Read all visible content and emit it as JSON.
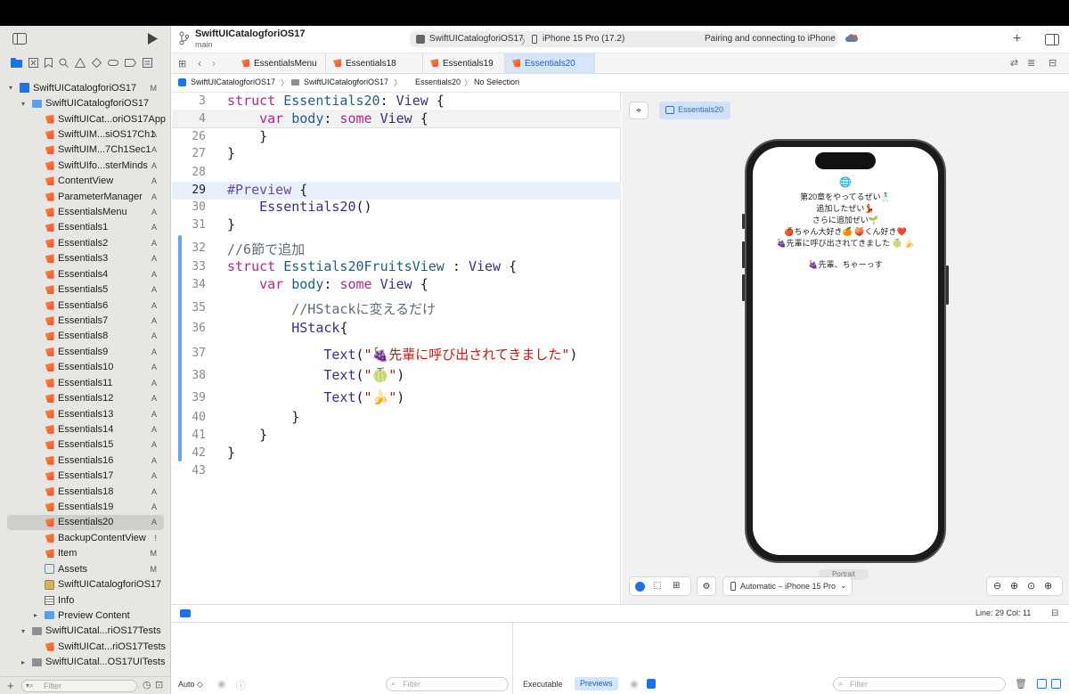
{
  "toolbar": {
    "project_name": "SwiftUICatalogforiOS17",
    "branch": "main",
    "scheme": "SwiftUICatalogforiOS17",
    "destination": "iPhone 15 Pro (17.2)",
    "status": "Pairing and connecting to iPhone"
  },
  "tabs": [
    {
      "label": "EssentialsMenu"
    },
    {
      "label": "Essentials18"
    },
    {
      "label": "Essentials19"
    },
    {
      "label": "Essentials20"
    }
  ],
  "jumpbar": {
    "project": "SwiftUICatalogforiOS17",
    "group": "SwiftUICatalogforiOS17",
    "file": "Essentials20",
    "selection": "No Selection"
  },
  "navigator": [
    {
      "label": "SwiftUICatalogforiOS17",
      "badge": "M",
      "icon": "project-icon",
      "indent": 0,
      "disc": "v"
    },
    {
      "label": "SwiftUICatalogforiOS17",
      "badge": "",
      "icon": "folder-icon",
      "indent": 1,
      "disc": "v"
    },
    {
      "label": "SwiftUICat...oriOS17App",
      "badge": "",
      "icon": "swift-file-icon",
      "indent": 2,
      "disc": ""
    },
    {
      "label": "SwiftUIM...siOS17Ch1",
      "badge": "A",
      "icon": "swift-file-icon",
      "indent": 2,
      "disc": ""
    },
    {
      "label": "SwiftUIM...7Ch1Sec1",
      "badge": "A",
      "icon": "swift-file-icon",
      "indent": 2,
      "disc": ""
    },
    {
      "label": "SwiftUIfo...sterMinds",
      "badge": "A",
      "icon": "swift-file-icon",
      "indent": 2,
      "disc": ""
    },
    {
      "label": "ContentView",
      "badge": "A",
      "icon": "swift-file-icon",
      "indent": 2,
      "disc": ""
    },
    {
      "label": "ParameterManager",
      "badge": "A",
      "icon": "swift-file-icon",
      "indent": 2,
      "disc": ""
    },
    {
      "label": "EssentialsMenu",
      "badge": "A",
      "icon": "swift-file-icon",
      "indent": 2,
      "disc": ""
    },
    {
      "label": "Essentials1",
      "badge": "A",
      "icon": "swift-file-icon",
      "indent": 2,
      "disc": ""
    },
    {
      "label": "Essentials2",
      "badge": "A",
      "icon": "swift-file-icon",
      "indent": 2,
      "disc": ""
    },
    {
      "label": "Essentials3",
      "badge": "A",
      "icon": "swift-file-icon",
      "indent": 2,
      "disc": ""
    },
    {
      "label": "Essentials4",
      "badge": "A",
      "icon": "swift-file-icon",
      "indent": 2,
      "disc": ""
    },
    {
      "label": "Essentials5",
      "badge": "A",
      "icon": "swift-file-icon",
      "indent": 2,
      "disc": ""
    },
    {
      "label": "Essentials6",
      "badge": "A",
      "icon": "swift-file-icon",
      "indent": 2,
      "disc": ""
    },
    {
      "label": "Essentials7",
      "badge": "A",
      "icon": "swift-file-icon",
      "indent": 2,
      "disc": ""
    },
    {
      "label": "Essentials8",
      "badge": "A",
      "icon": "swift-file-icon",
      "indent": 2,
      "disc": ""
    },
    {
      "label": "Essentials9",
      "badge": "A",
      "icon": "swift-file-icon",
      "indent": 2,
      "disc": ""
    },
    {
      "label": "Essentials10",
      "badge": "A",
      "icon": "swift-file-icon",
      "indent": 2,
      "disc": ""
    },
    {
      "label": "Essentials11",
      "badge": "A",
      "icon": "swift-file-icon",
      "indent": 2,
      "disc": ""
    },
    {
      "label": "Essentials12",
      "badge": "A",
      "icon": "swift-file-icon",
      "indent": 2,
      "disc": ""
    },
    {
      "label": "Essentials13",
      "badge": "A",
      "icon": "swift-file-icon",
      "indent": 2,
      "disc": ""
    },
    {
      "label": "Essentials14",
      "badge": "A",
      "icon": "swift-file-icon",
      "indent": 2,
      "disc": ""
    },
    {
      "label": "Essentials15",
      "badge": "A",
      "icon": "swift-file-icon",
      "indent": 2,
      "disc": ""
    },
    {
      "label": "Essentials16",
      "badge": "A",
      "icon": "swift-file-icon",
      "indent": 2,
      "disc": ""
    },
    {
      "label": "Essentials17",
      "badge": "A",
      "icon": "swift-file-icon",
      "indent": 2,
      "disc": ""
    },
    {
      "label": "Essentials18",
      "badge": "A",
      "icon": "swift-file-icon",
      "indent": 2,
      "disc": ""
    },
    {
      "label": "Essentials19",
      "badge": "A",
      "icon": "swift-file-icon",
      "indent": 2,
      "disc": ""
    },
    {
      "label": "Essentials20",
      "badge": "A",
      "icon": "swift-file-icon",
      "indent": 2,
      "disc": "",
      "selected": true
    },
    {
      "label": "BackupContentView",
      "badge": "!",
      "icon": "swift-file-icon",
      "indent": 2,
      "disc": ""
    },
    {
      "label": "Item",
      "badge": "M",
      "icon": "swift-file-icon",
      "indent": 2,
      "disc": ""
    },
    {
      "label": "Assets",
      "badge": "M",
      "icon": "asset-catalog-icon",
      "indent": 2,
      "disc": ""
    },
    {
      "label": "SwiftUICatalogforiOS17",
      "badge": "",
      "icon": "entitlements-icon",
      "indent": 2,
      "disc": ""
    },
    {
      "label": "Info",
      "badge": "",
      "icon": "plist-icon",
      "indent": 2,
      "disc": ""
    },
    {
      "label": "Preview Content",
      "badge": "",
      "icon": "folder-icon",
      "indent": 2,
      "disc": ">"
    },
    {
      "label": "SwiftUICatal...riOS17Tests",
      "badge": "",
      "icon": "folder-gray-icon",
      "indent": 1,
      "disc": "v"
    },
    {
      "label": "SwiftUICat...riOS17Tests",
      "badge": "",
      "icon": "swift-file-icon",
      "indent": 2,
      "disc": ""
    },
    {
      "label": "SwiftUICatal...OS17UITests",
      "badge": "",
      "icon": "folder-gray-icon",
      "indent": 1,
      "disc": ">"
    }
  ],
  "code": [
    {
      "n": "3",
      "html": "<span class='kw'>struct</span> <span class='id'>Essentials20</span>: <span class='ty'>View</span> {"
    },
    {
      "n": "4",
      "html": "    <span class='kw'>var</span> <span class='id'>body</span>: <span class='kw'>some</span> <span class='ty'>View</span> {"
    },
    {
      "n": "26",
      "html": "    }"
    },
    {
      "n": "27",
      "html": "}"
    },
    {
      "n": "28",
      "html": ""
    },
    {
      "n": "29",
      "html": "<span class='pp'>#Preview</span> {"
    },
    {
      "n": "30",
      "html": "    <span class='ty'>Essentials20</span>()"
    },
    {
      "n": "31",
      "html": "}"
    },
    {
      "n": "32",
      "html": "<span class='cm'>//6節で追加</span>"
    },
    {
      "n": "33",
      "html": "<span class='kw'>struct</span> <span class='id'>Esstials20FruitsView</span> : <span class='ty'>View</span> {"
    },
    {
      "n": "34",
      "html": "    <span class='kw'>var</span> <span class='id'>body</span>: <span class='kw'>some</span> <span class='ty'>View</span> {"
    },
    {
      "n": "35",
      "html": "        <span class='cm'>//HStackに変えるだけ</span>"
    },
    {
      "n": "36",
      "html": "        <span class='ty'>HStack</span>{"
    },
    {
      "n": "37",
      "html": "            <span class='ty'>Text</span>(<span class='st'>\"🍇先輩に呼び出されてきました\"</span>)"
    },
    {
      "n": "38",
      "html": "            <span class='ty'>Text</span>(<span class='st'>\"🍈\"</span>)"
    },
    {
      "n": "39",
      "html": "            <span class='ty'>Text</span>(<span class='st'>\"🍌\"</span>)"
    },
    {
      "n": "40",
      "html": "        }"
    },
    {
      "n": "41",
      "html": "    }"
    },
    {
      "n": "42",
      "html": "}"
    },
    {
      "n": "43",
      "html": ""
    }
  ],
  "preview": {
    "globe": "🌐",
    "lines": [
      "第20章をやってるぜい🕺",
      "追加したぜい💃",
      "さらに追加ぜい🌱",
      "🍎ちゃん大好き🍊 🍑くん好き❤️",
      "🍇先輩に呼び出されてきました 🍈 🍌",
      "",
      "🍇先輩、ちゃーっす"
    ],
    "portrait_label": "Portrait",
    "device_menu": "Automatic – iPhone 15 Pro"
  },
  "status": {
    "cursor": "Line: 29  Col: 11"
  },
  "bottom": {
    "scheme_filter": "Auto ◇",
    "filter_placeholder": "Filter",
    "executable_tab": "Executable",
    "previews_tab": "Previews",
    "nav_filter_placeholder": "Filter"
  }
}
